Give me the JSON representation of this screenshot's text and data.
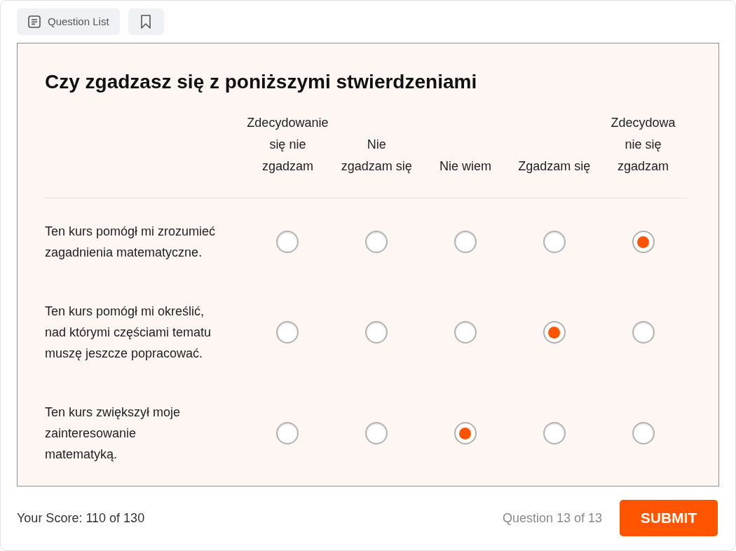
{
  "toolbar": {
    "question_list": {
      "label": "Question List"
    }
  },
  "question": {
    "title": "Czy zgadzasz się z poniższymi stwierdzeniami",
    "columns": [
      "Zdecydowanie\nsię nie\nzgadzam",
      "Nie\nzgadzam się",
      "Nie wiem",
      "Zgadzam się",
      "Zdecydowa\nnie się\nzgadzam"
    ],
    "rows": [
      {
        "statement": "Ten kurs pomógł mi zrozumieć\nzagadnienia matematyczne.",
        "choices": [
          {
            "selected": false
          },
          {
            "selected": false
          },
          {
            "selected": false
          },
          {
            "selected": false
          },
          {
            "selected": true
          }
        ]
      },
      {
        "statement": "Ten kurs pomógł mi określić,\nnad którymi częściami tematu\nmuszę jeszcze popracować.",
        "choices": [
          {
            "selected": false
          },
          {
            "selected": false
          },
          {
            "selected": false
          },
          {
            "selected": true
          },
          {
            "selected": false
          }
        ]
      },
      {
        "statement": "Ten kurs zwiększył moje\nzainteresowanie\nmatematyką.",
        "choices": [
          {
            "selected": false
          },
          {
            "selected": false
          },
          {
            "selected": true
          },
          {
            "selected": false
          },
          {
            "selected": false
          }
        ]
      }
    ]
  },
  "footer": {
    "score": "Your Score: 110 of 130",
    "progress": "Question 13 of 13",
    "submit": "SUBMIT"
  }
}
